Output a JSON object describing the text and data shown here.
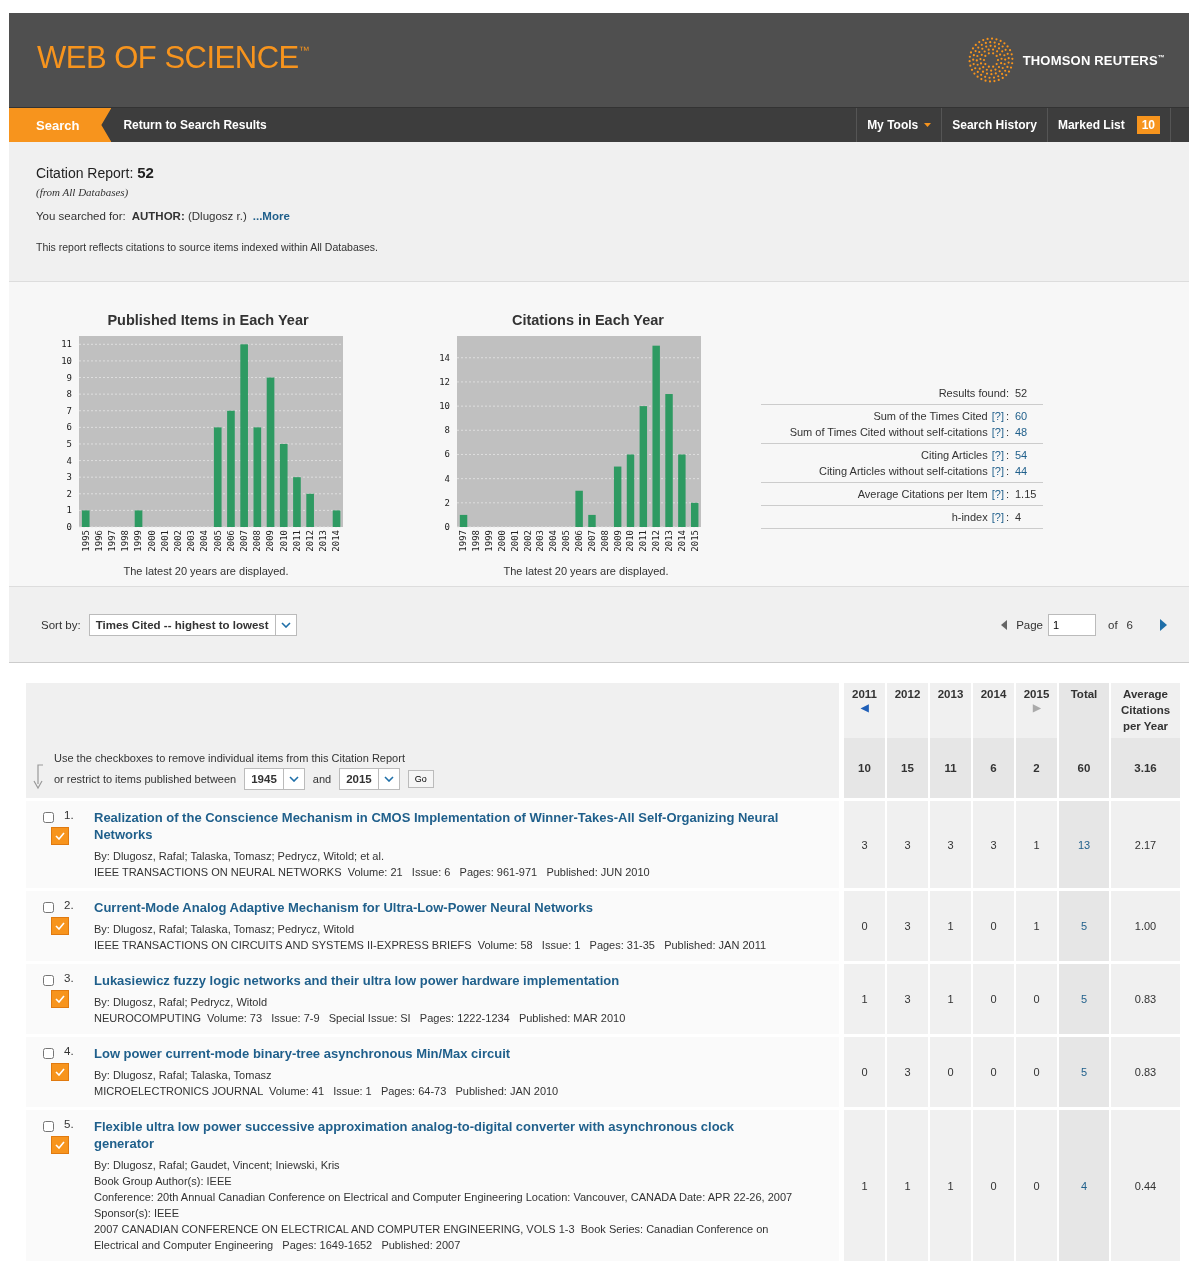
{
  "header": {
    "logo": "WEB OF SCIENCE$^{™}$",
    "brand": "THOMSON REUTERS$^{™}$"
  },
  "nav": {
    "tabs": [
      {
        "label": "Search",
        "selected": true
      },
      {
        "label": "Return to Search Results",
        "selected": false
      }
    ],
    "tools": [
      {
        "label": "My Tools",
        "kind": "menu"
      },
      {
        "label": "Search History",
        "kind": "link"
      },
      {
        "label": "Marked List",
        "kind": "count",
        "count": "10"
      }
    ]
  },
  "report": {
    "title": "Citation Report:",
    "count": "52",
    "source": "(from All Databases)",
    "query_label": "You searched for:",
    "query": "**AUTHOR:** (Dlugosz r.)",
    "more": "...More",
    "note": "This report reflects citations to source items indexed within All Databases."
  },
  "charts": [
    {
      "footnote": "The latest 20 years are displayed.",
      "chart_data": {
        "type": "bar",
        "title": "Published Items in Each Year",
        "categories": [
          "1995",
          "1996",
          "1997",
          "1998",
          "1999",
          "2000",
          "2001",
          "2002",
          "2003",
          "2004",
          "2005",
          "2006",
          "2007",
          "2008",
          "2009",
          "2010",
          "2011",
          "2012",
          "2013",
          "2014"
        ],
        "values": [
          1,
          0,
          0,
          0,
          1,
          0,
          0,
          0,
          0,
          0,
          6,
          7,
          11,
          6,
          9,
          5,
          3,
          2,
          0,
          1
        ],
        "grid": true,
        "ylim": [
          0,
          11.5
        ],
        "yticks": [
          0,
          1,
          2,
          3,
          4,
          5,
          6,
          7,
          8,
          9,
          10,
          11
        ]
      }
    },
    {
      "footnote": "The latest 20 years are displayed.",
      "chart_data": {
        "type": "bar",
        "title": "Citations in Each Year",
        "categories": [
          "1997",
          "1998",
          "1999",
          "2000",
          "2001",
          "2002",
          "2003",
          "2004",
          "2005",
          "2006",
          "2007",
          "2008",
          "2009",
          "2010",
          "2011",
          "2012",
          "2013",
          "2014",
          "2015"
        ],
        "values": [
          1,
          0,
          0,
          0,
          0,
          0,
          0,
          0,
          0,
          3,
          1,
          0,
          5,
          6,
          10,
          15,
          11,
          6,
          2
        ],
        "grid": true,
        "ylim": [
          0,
          15.8
        ],
        "yticks": [
          0,
          2,
          4,
          6,
          8,
          10,
          12,
          14
        ]
      }
    }
  ],
  "stats": [
    [
      {
        "label": "Results found:",
        "value": "52",
        "link": false
      }
    ],
    [
      {
        "label": "Sum of the Times Cited",
        "help": "[?]",
        "separator": ":",
        "value": "60",
        "link": true
      },
      {
        "label": "Sum of Times Cited without self-citations",
        "help": "[?]",
        "separator": ":",
        "value": "48",
        "link": true
      }
    ],
    [
      {
        "label": "Citing Articles",
        "help": "[?]",
        "separator": ":",
        "value": "54",
        "link": true
      },
      {
        "label": "Citing Articles without self-citations",
        "help": "[?]",
        "separator": ":",
        "value": "44",
        "link": true
      }
    ],
    [
      {
        "label": "Average Citations per Item",
        "help": "[?]",
        "separator": ":",
        "value": "1.15",
        "link": false
      }
    ],
    [
      {
        "label": "h-index",
        "help": "[?]",
        "separator": ":",
        "value": "4",
        "link": false
      }
    ]
  ],
  "sort": {
    "label": "Sort by:",
    "value": "Times Cited -- highest to lowest"
  },
  "pager": {
    "label": "Page",
    "value": "1",
    "of": "of",
    "total": "6"
  },
  "table": {
    "years": [
      {
        "label": "2011",
        "arrow": "◀",
        "enabled": true
      },
      {
        "label": "2012"
      },
      {
        "label": "2013"
      },
      {
        "label": "2014"
      },
      {
        "label": "2015",
        "arrow": "▶",
        "enabled": false
      }
    ],
    "total_label": "Total",
    "average_label": "Average Citations per Year",
    "instructions": "Use the checkboxes to remove individual items from this Citation Report",
    "restrict_label": "or restrict to items published between",
    "from": "1945",
    "and": "and",
    "to": "2015",
    "go": "Go",
    "totals": {
      "years": [
        "10",
        "15",
        "11",
        "6",
        "2"
      ],
      "total": "60",
      "average": "3.16"
    },
    "rows": [
      {
        "number": "1.",
        "remove": false,
        "marked": true,
        "title": "Realization of the Conscience Mechanism in CMOS Implementation of Winner-Takes-All Self-Organizing Neural Networks",
        "details": [
          "By: Dlugosz, Rafal; Talaska, Tomasz; Pedrycz, Witold; et al.",
          "IEEE TRANSACTIONS ON NEURAL NETWORKS  Volume: 21   Issue: 6   Pages: 961-971   Published: JUN 2010"
        ],
        "years": [
          "3",
          "3",
          "3",
          "3",
          "1"
        ],
        "total": "13",
        "average": "2.17"
      },
      {
        "number": "2.",
        "remove": false,
        "marked": true,
        "title": "Current-Mode Analog Adaptive Mechanism for Ultra-Low-Power Neural Networks",
        "details": [
          "By: Dlugosz, Rafal; Talaska, Tomasz; Pedrycz, Witold",
          "IEEE TRANSACTIONS ON CIRCUITS AND SYSTEMS II-EXPRESS BRIEFS  Volume: 58   Issue: 1   Pages: 31-35   Published: JAN 2011"
        ],
        "years": [
          "0",
          "3",
          "1",
          "0",
          "1"
        ],
        "total": "5",
        "average": "1.00"
      },
      {
        "number": "3.",
        "remove": false,
        "marked": true,
        "title": "Lukasiewicz fuzzy logic networks and their ultra low power hardware implementation",
        "details": [
          "By: Dlugosz, Rafal; Pedrycz, Witold",
          "NEUROCOMPUTING  Volume: 73   Issue: 7-9   Special Issue: SI   Pages: 1222-1234   Published: MAR 2010"
        ],
        "years": [
          "1",
          "3",
          "1",
          "0",
          "0"
        ],
        "total": "5",
        "average": "0.83"
      },
      {
        "number": "4.",
        "remove": false,
        "marked": true,
        "title": "Low power current-mode binary-tree asynchronous Min/Max circuit",
        "details": [
          "By: Dlugosz, Rafal; Talaska, Tomasz",
          "MICROELECTRONICS JOURNAL  Volume: 41   Issue: 1   Pages: 64-73   Published: JAN 2010"
        ],
        "years": [
          "0",
          "3",
          "0",
          "0",
          "0"
        ],
        "total": "5",
        "average": "0.83"
      },
      {
        "number": "5.",
        "remove": false,
        "marked": true,
        "title": "Flexible ultra low power successive approximation analog-to-digital converter with asynchronous clock generator",
        "details": [
          "By: Dlugosz, Rafal; Gaudet, Vincent; Iniewski, Kris",
          "Book Group Author(s): IEEE",
          "Conference: 20th Annual Canadian Conference on Electrical and Computer Engineering Location: Vancouver, CANADA Date: APR 22-26, 2007",
          "Sponsor(s): IEEE",
          "2007 CANADIAN CONFERENCE ON ELECTRICAL AND COMPUTER ENGINEERING, VOLS 1-3  Book Series: Canadian Conference on Electrical and Computer Engineering   Pages: 1649-1652   Published: 2007"
        ],
        "years": [
          "1",
          "1",
          "1",
          "0",
          "0"
        ],
        "total": "4",
        "average": "0.44"
      }
    ]
  }
}
